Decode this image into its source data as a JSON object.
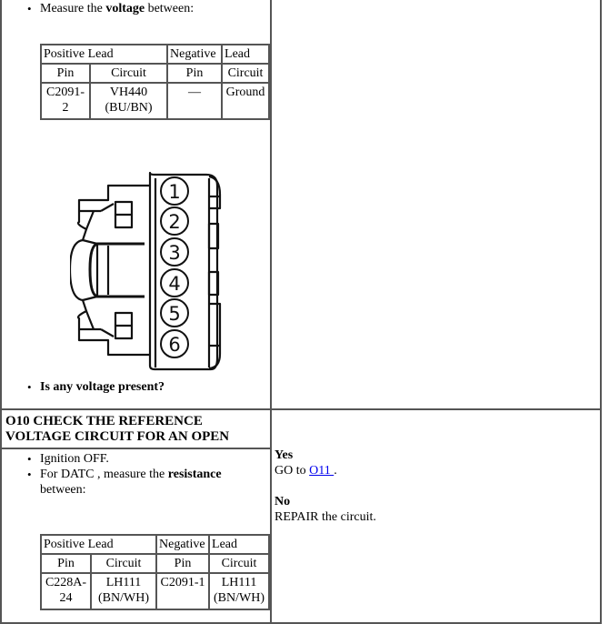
{
  "step_o9": {
    "instruction_prefix": "Measure the ",
    "instruction_bold": "voltage",
    "instruction_suffix": " between:",
    "table": {
      "header_row": [
        "Positive",
        "Lead",
        "Negative",
        "Lead"
      ],
      "sub_headers": [
        "Pin",
        "Circuit",
        "Pin",
        "Circuit"
      ],
      "rows": [
        [
          "C2091-2",
          "VH440 (BU/BN)",
          "—",
          "Ground"
        ]
      ]
    },
    "connector_diagram": {
      "icon": "connector-6-pin-diagram",
      "pins": [
        "1",
        "2",
        "3",
        "4",
        "5",
        "6"
      ]
    },
    "question": "Is any voltage present?"
  },
  "step_o10": {
    "heading": "O10 CHECK THE REFERENCE VOLTAGE CIRCUIT FOR AN OPEN",
    "instructions": [
      {
        "text": "Ignition OFF."
      },
      {
        "prefix": "For DATC , measure the ",
        "bold": "resistance",
        "suffix": " between:"
      }
    ],
    "table": {
      "header_row": [
        "Positive",
        "Lead",
        "Negative",
        "Lead"
      ],
      "sub_headers": [
        "Pin",
        "Circuit",
        "Pin",
        "Circuit"
      ],
      "rows": [
        [
          "C228A-24",
          "LH111 (BN/WH)",
          "C2091-1",
          "LH111 (BN/WH)"
        ]
      ]
    },
    "results": {
      "yes_label": "Yes",
      "yes_action_prefix": "GO to ",
      "yes_link": "O11 ",
      "yes_action_suffix": ".",
      "no_label": "No",
      "no_action": "REPAIR the circuit."
    }
  }
}
